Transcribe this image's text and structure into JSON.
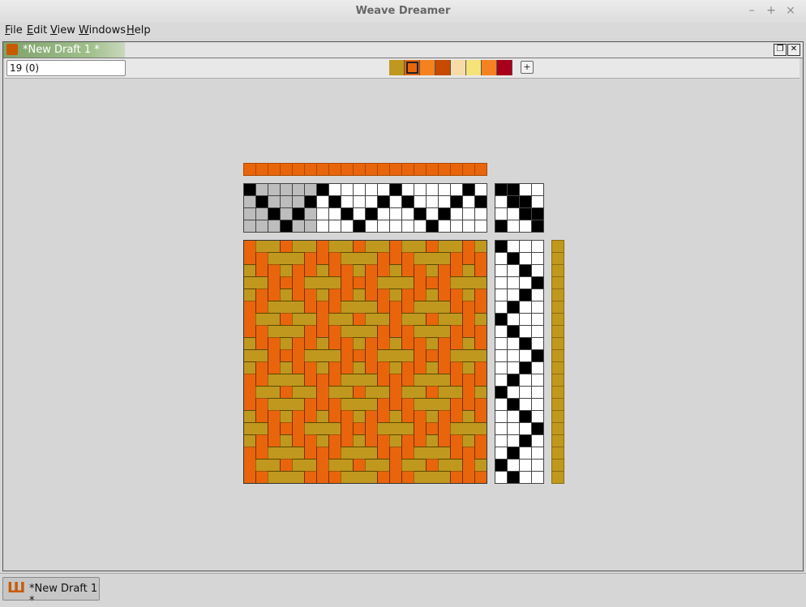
{
  "window": {
    "title": "Weave Dreamer",
    "controls": {
      "minimize": "–",
      "maximize": "+",
      "close": "×"
    }
  },
  "menu": {
    "file": "File",
    "edit": "Edit",
    "view": "View",
    "windows": "Windows",
    "help": "Help"
  },
  "document": {
    "tab_title": "*New Draft 1 *",
    "restore_label": "❐",
    "close_label": "✕",
    "status_value": "19 (0)",
    "add_color_label": "+"
  },
  "palette": [
    "#c0981e",
    "#e8650c",
    "#f5821f",
    "#c84a00",
    "#f7dca8",
    "#f5e37a",
    "#f58220",
    "#a8001c"
  ],
  "palette_selected": 1,
  "draft": {
    "ends": 20,
    "picks": 20,
    "shafts": 4,
    "treadles": 4,
    "warp_color": "#e8650c",
    "weft_color": "#c0981e",
    "grid_color": "#444444",
    "threading": [
      4,
      3,
      2,
      1,
      2,
      3,
      4,
      3,
      2,
      1,
      2,
      3,
      4,
      3,
      2,
      1,
      2,
      3,
      4,
      3
    ],
    "tieup": [
      [
        1,
        4
      ],
      [
        3,
        4
      ],
      [
        2,
        3
      ],
      [
        1,
        2
      ]
    ],
    "treadling": [
      1,
      2,
      3,
      4,
      3,
      2,
      1,
      2,
      3,
      4,
      3,
      2,
      1,
      2,
      3,
      4,
      3,
      2,
      1,
      2
    ],
    "shaded_threading_ends": 6
  },
  "taskbar": {
    "item_label": "*New Draft 1 *",
    "app_icon": "loom-icon"
  }
}
